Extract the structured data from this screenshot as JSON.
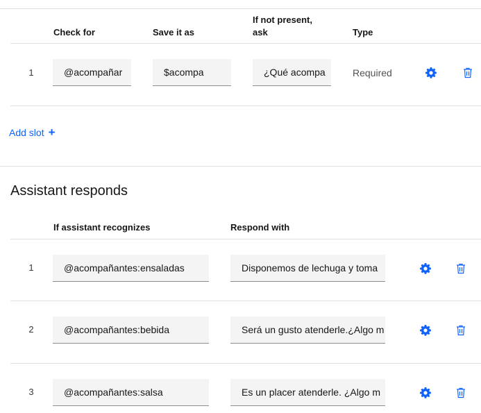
{
  "slots": {
    "headers": {
      "check_for": "Check for",
      "save_it_as": "Save it as",
      "if_not_present_line1": "If not present,",
      "if_not_present_line2": "ask",
      "type": "Type"
    },
    "rows": [
      {
        "num": "1",
        "check_for": "@acompañar",
        "save_it_as": "$acompa",
        "ask": "¿Qué acompa",
        "type": "Required"
      }
    ],
    "add_slot_label": "Add slot",
    "add_slot_icon": "plus-icon"
  },
  "assistant_responds": {
    "title": "Assistant responds",
    "headers": {
      "recognizes": "If assistant recognizes",
      "respond_with": "Respond with"
    },
    "rows": [
      {
        "num": "1",
        "condition": "@acompañantes:ensaladas",
        "response": "Disponemos de lechuga y toma"
      },
      {
        "num": "2",
        "condition": "@acompañantes:bebida",
        "response": "Será un gusto atenderle.¿Algo m"
      },
      {
        "num": "3",
        "condition": "@acompañantes:salsa",
        "response": "Es un placer atenderle. ¿Algo m"
      }
    ]
  },
  "icons": {
    "settings": "gear-icon",
    "delete": "trash-icon"
  },
  "colors": {
    "accent": "#0f62fe",
    "field_bg": "#f4f4f4",
    "divider": "#e0e0e0"
  }
}
